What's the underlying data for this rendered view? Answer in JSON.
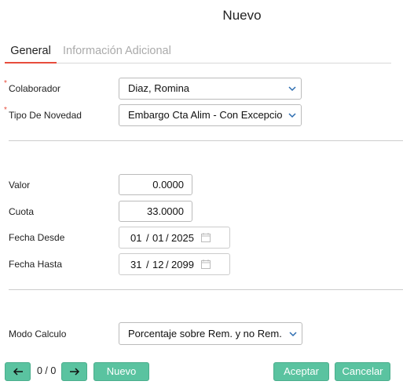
{
  "dialog": {
    "title": "Nuevo"
  },
  "tabs": [
    {
      "label": "General"
    },
    {
      "label": "Información Adicional"
    }
  ],
  "form": {
    "required_marker": "*",
    "colaborador": {
      "label": "Colaborador",
      "value": "Diaz, Romina"
    },
    "tipo_novedad": {
      "label": "Tipo De Novedad",
      "value": "Embargo Cta Alim - Con Excepciones"
    },
    "valor": {
      "label": "Valor",
      "value": "0.0000"
    },
    "cuota": {
      "label": "Cuota",
      "value": "33.0000"
    },
    "fecha_desde": {
      "label": "Fecha Desde",
      "day": "01",
      "month": "01",
      "year": "2025",
      "sep": "/"
    },
    "fecha_hasta": {
      "label": "Fecha Hasta",
      "day": "31",
      "month": "12",
      "year": "2099",
      "sep": "/"
    },
    "modo_calculo": {
      "label": "Modo Calculo",
      "value": "Porcentaje sobre Rem. y no Rem."
    }
  },
  "footer": {
    "prev_icon": "arrow-left-icon",
    "next_icon": "arrow-right-icon",
    "pager_text": "0 / 0",
    "nuevo_label": "Nuevo",
    "aceptar_label": "Aceptar",
    "cancelar_label": "Cancelar"
  },
  "colors": {
    "accent_tab": "#e74c3c",
    "button_green": "#5ac3a0",
    "chevron_blue": "#2b6cb0"
  }
}
